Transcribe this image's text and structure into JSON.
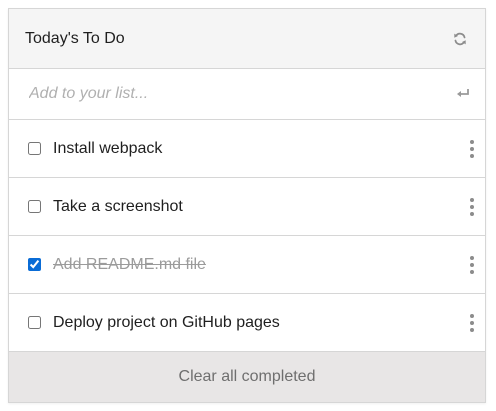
{
  "header": {
    "title": "Today's To Do",
    "refresh_icon": "refresh-icon"
  },
  "add": {
    "placeholder": "Add to your list...",
    "value": "",
    "enter_icon": "enter-icon"
  },
  "items": [
    {
      "label": "Install webpack",
      "checked": false
    },
    {
      "label": "Take a screenshot",
      "checked": false
    },
    {
      "label": "Add README.md file",
      "checked": true
    },
    {
      "label": "Deploy project on GitHub pages",
      "checked": false
    }
  ],
  "footer": {
    "clear_label": "Clear all completed"
  },
  "colors": {
    "header_bg": "#f5f5f5",
    "footer_bg": "#e8e6e6",
    "border": "#d6d6d6",
    "checkbox_accent": "#0a6cd6",
    "completed_text": "#9b9b9b"
  }
}
